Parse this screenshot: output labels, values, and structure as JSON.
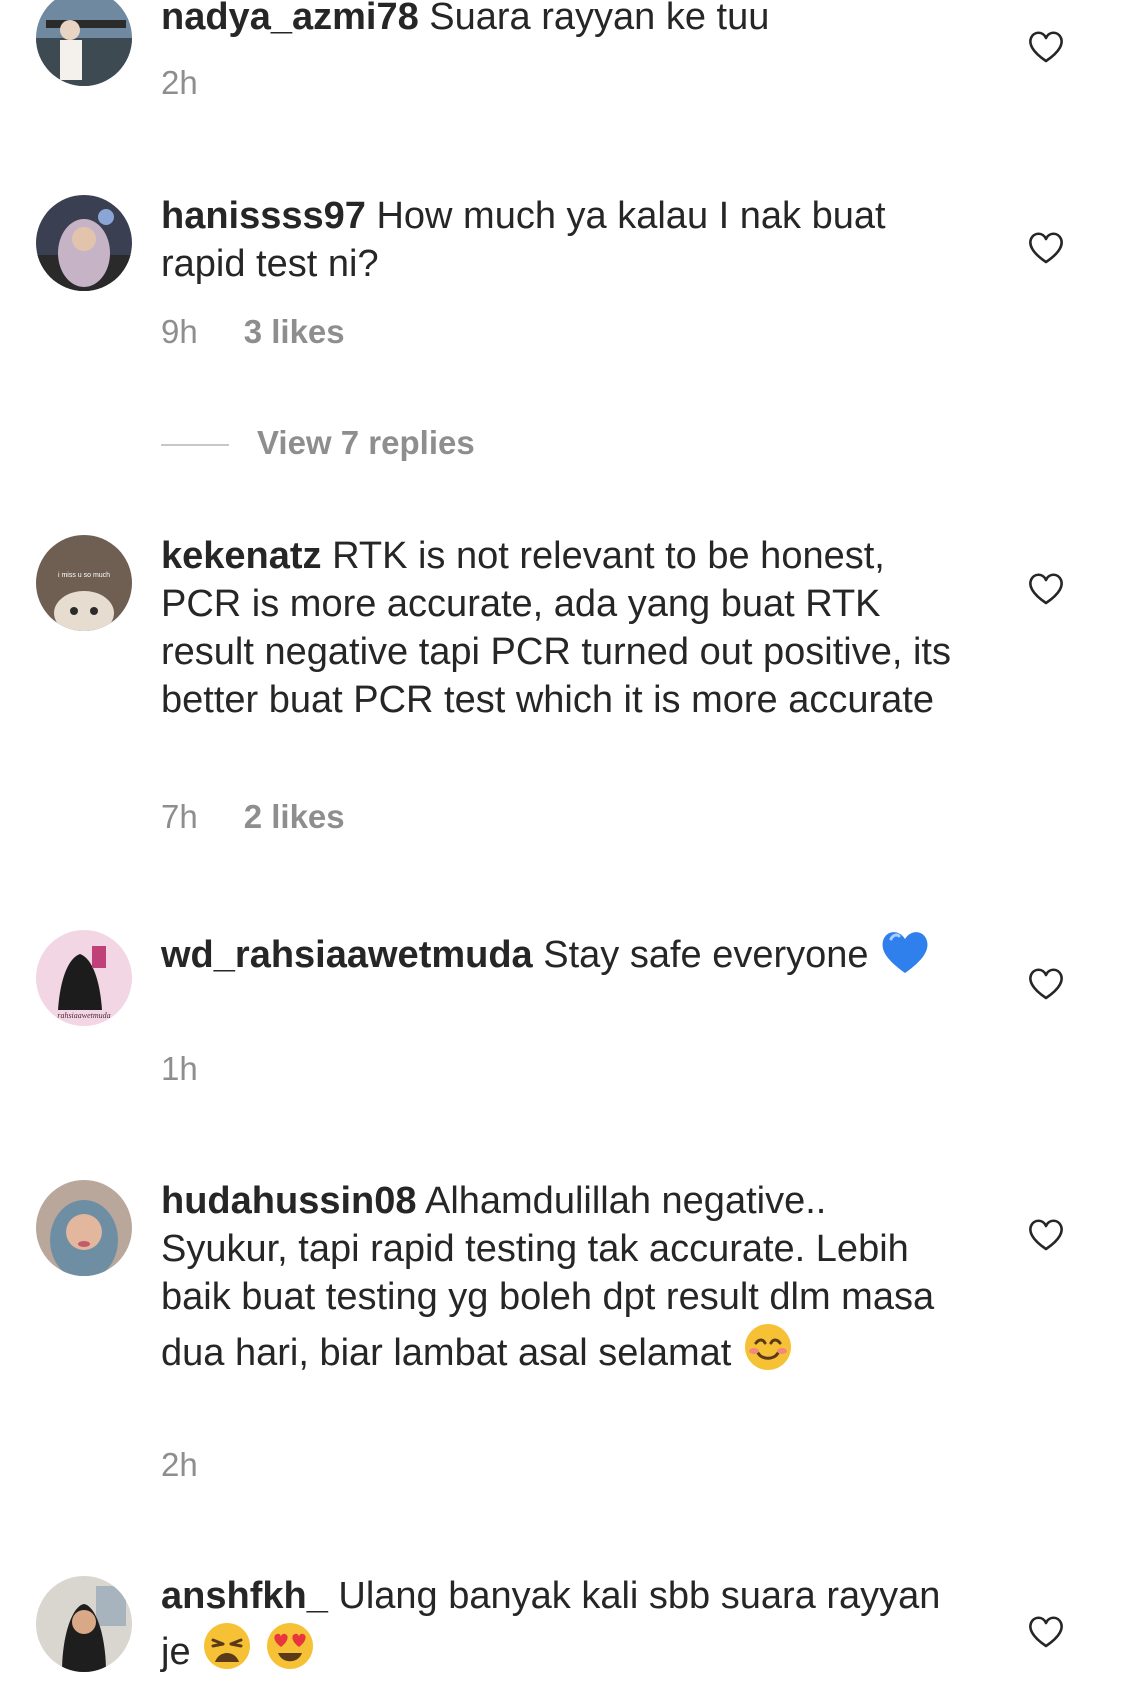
{
  "comments": [
    {
      "username": "nadya_azmi78",
      "text": "Suara rayyan ke tuu",
      "time": "2h",
      "likes": ""
    },
    {
      "username": "hanissss97",
      "text": "How much ya kalau I nak buat rapid test ni?",
      "time": "9h",
      "likes": "3 likes",
      "view_replies": "View 7 replies"
    },
    {
      "username": "kekenatz",
      "text": "RTK is not relevant to be honest, PCR is more accurate, ada yang buat RTK result negative tapi PCR turned out positive, its better buat PCR test which it is more accurate",
      "avatar_caption": "i miss u so much",
      "time": "7h",
      "likes": "2 likes"
    },
    {
      "username": "wd_rahsiaawetmuda",
      "text": "Stay safe everyone",
      "emoji": [
        "blue-heart"
      ],
      "avatar_caption": "rahsiaawetmuda",
      "time": "1h",
      "likes": ""
    },
    {
      "username": "hudahussin08",
      "text": "Alhamdulillah negative.. Syukur, tapi rapid testing tak accurate. Lebih baik buat testing yg boleh dpt result dlm masa dua hari, biar lambat asal selamat",
      "emoji": [
        "smiling-face-emoji"
      ],
      "time": "2h",
      "likes": ""
    },
    {
      "username": "anshfkh_",
      "text": "Ulang banyak kali sbb suara rayyan je",
      "emoji": [
        "weary-face-emoji",
        "heart-eyes-emoji"
      ],
      "time": "",
      "likes": ""
    }
  ],
  "icons": {
    "like": "heart-outline-icon"
  },
  "colors": {
    "text": "#262626",
    "meta": "#8e8e8e",
    "blue_heart": "#2f80ed",
    "emoji_yellow": "#f7c136"
  }
}
